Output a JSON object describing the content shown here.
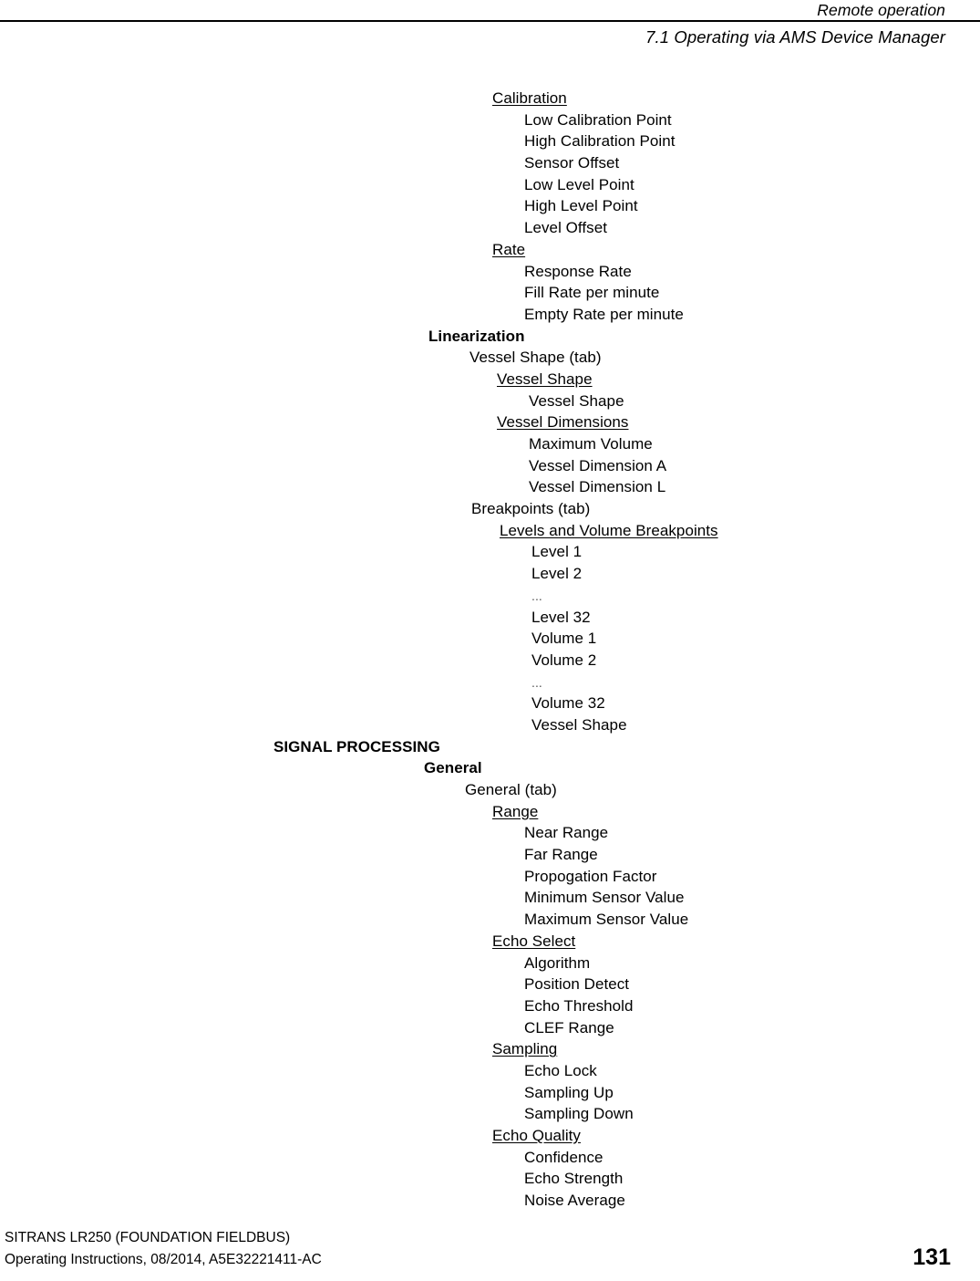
{
  "header": {
    "title": "Remote operation",
    "subtitle": "7.1 Operating via AMS Device Manager"
  },
  "footer": {
    "product": "SITRANS LR250 (FOUNDATION FIELDBUS)",
    "document": "Operating Instructions, 08/2014, A5E32221411-AC",
    "page_number": "131"
  },
  "tree": [
    {
      "text": "Calibration",
      "indent": 540,
      "bold": false,
      "underline": true
    },
    {
      "text": "Low Calibration Point",
      "indent": 575,
      "bold": false,
      "underline": false
    },
    {
      "text": "High Calibration Point",
      "indent": 575,
      "bold": false,
      "underline": false
    },
    {
      "text": "Sensor Offset",
      "indent": 575,
      "bold": false,
      "underline": false
    },
    {
      "text": "Low Level Point",
      "indent": 575,
      "bold": false,
      "underline": false
    },
    {
      "text": "High Level Point",
      "indent": 575,
      "bold": false,
      "underline": false
    },
    {
      "text": "Level Offset",
      "indent": 575,
      "bold": false,
      "underline": false
    },
    {
      "text": "Rate",
      "indent": 540,
      "bold": false,
      "underline": true
    },
    {
      "text": "Response Rate",
      "indent": 575,
      "bold": false,
      "underline": false
    },
    {
      "text": "Fill Rate per minute",
      "indent": 575,
      "bold": false,
      "underline": false
    },
    {
      "text": "Empty Rate per minute",
      "indent": 575,
      "bold": false,
      "underline": false
    },
    {
      "text": "Linearization",
      "indent": 470,
      "bold": true,
      "underline": false
    },
    {
      "text": "Vessel Shape (tab)",
      "indent": 515,
      "bold": false,
      "underline": false
    },
    {
      "text": "Vessel Shape",
      "indent": 545,
      "bold": false,
      "underline": true
    },
    {
      "text": "Vessel Shape",
      "indent": 580,
      "bold": false,
      "underline": false
    },
    {
      "text": "Vessel Dimensions",
      "indent": 545,
      "bold": false,
      "underline": true
    },
    {
      "text": "Maximum Volume",
      "indent": 580,
      "bold": false,
      "underline": false
    },
    {
      "text": "Vessel Dimension A",
      "indent": 580,
      "bold": false,
      "underline": false
    },
    {
      "text": "Vessel Dimension L",
      "indent": 580,
      "bold": false,
      "underline": false
    },
    {
      "text": "Breakpoints (tab)",
      "indent": 517,
      "bold": false,
      "underline": false
    },
    {
      "text": "Levels and Volume Breakpoints",
      "indent": 548,
      "bold": false,
      "underline": true
    },
    {
      "text": "Level 1",
      "indent": 583,
      "bold": false,
      "underline": false
    },
    {
      "text": "Level 2",
      "indent": 583,
      "bold": false,
      "underline": false
    },
    {
      "text": "...",
      "indent": 583,
      "bold": false,
      "underline": false,
      "ellipsis": true
    },
    {
      "text": "Level 32",
      "indent": 583,
      "bold": false,
      "underline": false
    },
    {
      "text": "Volume 1",
      "indent": 583,
      "bold": false,
      "underline": false
    },
    {
      "text": "Volume 2",
      "indent": 583,
      "bold": false,
      "underline": false
    },
    {
      "text": "...",
      "indent": 583,
      "bold": false,
      "underline": false,
      "ellipsis": true
    },
    {
      "text": "Volume 32",
      "indent": 583,
      "bold": false,
      "underline": false
    },
    {
      "text": "Vessel Shape",
      "indent": 583,
      "bold": false,
      "underline": false
    },
    {
      "text": "SIGNAL PROCESSING",
      "indent": 300,
      "bold": true,
      "underline": false
    },
    {
      "text": "General",
      "indent": 465,
      "bold": true,
      "underline": false
    },
    {
      "text": "General (tab)",
      "indent": 510,
      "bold": false,
      "underline": false
    },
    {
      "text": "Range",
      "indent": 540,
      "bold": false,
      "underline": true
    },
    {
      "text": "Near Range",
      "indent": 575,
      "bold": false,
      "underline": false
    },
    {
      "text": "Far Range",
      "indent": 575,
      "bold": false,
      "underline": false
    },
    {
      "text": "Propogation Factor",
      "indent": 575,
      "bold": false,
      "underline": false
    },
    {
      "text": "Minimum Sensor Value",
      "indent": 575,
      "bold": false,
      "underline": false
    },
    {
      "text": "Maximum Sensor Value",
      "indent": 575,
      "bold": false,
      "underline": false
    },
    {
      "text": "Echo Select",
      "indent": 540,
      "bold": false,
      "underline": true
    },
    {
      "text": "Algorithm",
      "indent": 575,
      "bold": false,
      "underline": false
    },
    {
      "text": "Position Detect",
      "indent": 575,
      "bold": false,
      "underline": false
    },
    {
      "text": "Echo Threshold",
      "indent": 575,
      "bold": false,
      "underline": false
    },
    {
      "text": "CLEF Range",
      "indent": 575,
      "bold": false,
      "underline": false
    },
    {
      "text": "Sampling",
      "indent": 540,
      "bold": false,
      "underline": true
    },
    {
      "text": "Echo Lock",
      "indent": 575,
      "bold": false,
      "underline": false
    },
    {
      "text": "Sampling Up",
      "indent": 575,
      "bold": false,
      "underline": false
    },
    {
      "text": "Sampling Down",
      "indent": 575,
      "bold": false,
      "underline": false
    },
    {
      "text": "Echo Quality",
      "indent": 540,
      "bold": false,
      "underline": true
    },
    {
      "text": "Confidence",
      "indent": 575,
      "bold": false,
      "underline": false
    },
    {
      "text": "Echo Strength",
      "indent": 575,
      "bold": false,
      "underline": false
    },
    {
      "text": "Noise Average",
      "indent": 575,
      "bold": false,
      "underline": false
    }
  ]
}
